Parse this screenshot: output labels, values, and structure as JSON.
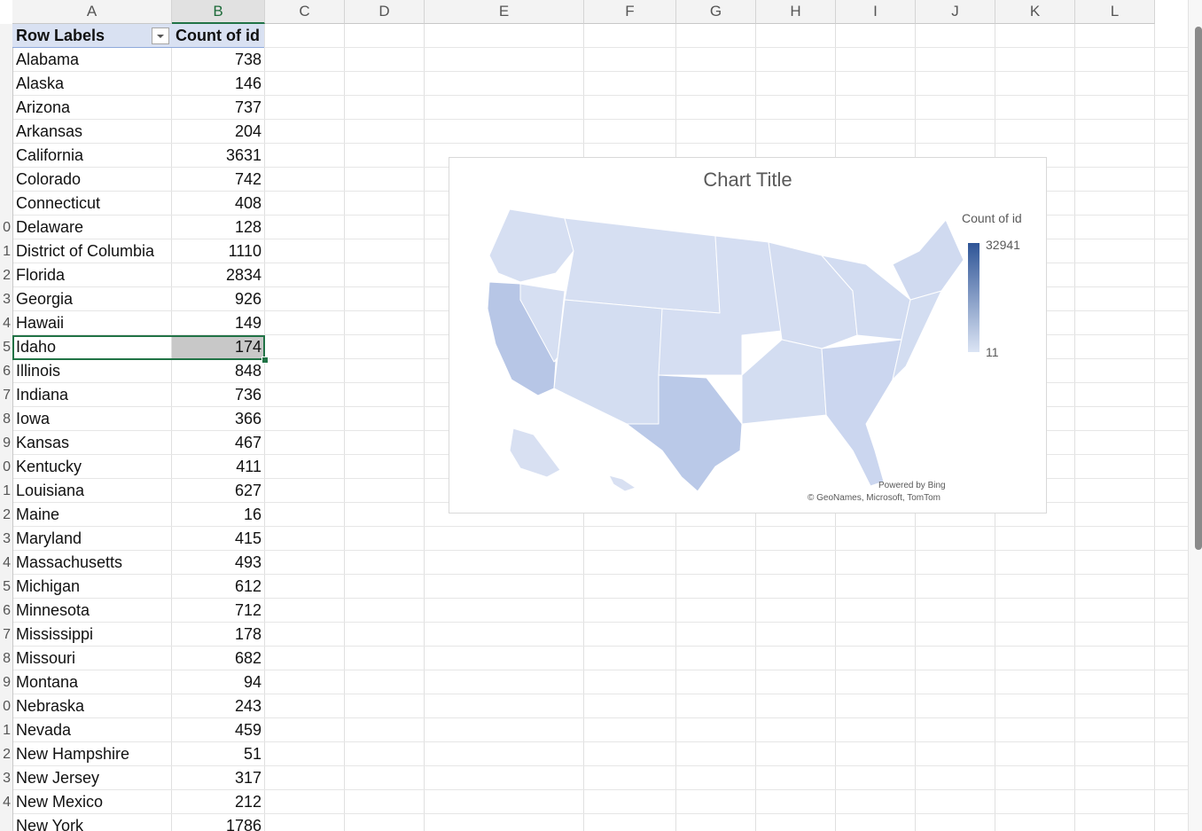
{
  "columns": [
    "A",
    "B",
    "C",
    "D",
    "E",
    "F",
    "G",
    "H",
    "I",
    "J",
    "K",
    "L"
  ],
  "active_column": "B",
  "row_numbers": [
    "",
    "",
    "",
    "",
    "",
    "",
    "",
    "",
    "",
    "0",
    "1",
    "2",
    "3",
    "4",
    "5",
    "6",
    "7",
    "8",
    "9",
    "0",
    "1",
    "2",
    "3",
    "4",
    "5",
    "6",
    "7",
    "8",
    "9",
    "0",
    "1",
    "2",
    "3",
    "4"
  ],
  "pivot": {
    "header_row_labels": "Row Labels",
    "header_count": "Count of id",
    "rows": [
      {
        "label": "Alabama",
        "value": "738"
      },
      {
        "label": "Alaska",
        "value": "146"
      },
      {
        "label": "Arizona",
        "value": "737"
      },
      {
        "label": "Arkansas",
        "value": "204"
      },
      {
        "label": "California",
        "value": "3631"
      },
      {
        "label": "Colorado",
        "value": "742"
      },
      {
        "label": "Connecticut",
        "value": "408"
      },
      {
        "label": "Delaware",
        "value": "128"
      },
      {
        "label": "District of Columbia",
        "value": "1110"
      },
      {
        "label": "Florida",
        "value": "2834"
      },
      {
        "label": "Georgia",
        "value": "926"
      },
      {
        "label": "Hawaii",
        "value": "149"
      },
      {
        "label": "Idaho",
        "value": "174"
      },
      {
        "label": "Illinois",
        "value": "848"
      },
      {
        "label": "Indiana",
        "value": "736"
      },
      {
        "label": "Iowa",
        "value": "366"
      },
      {
        "label": "Kansas",
        "value": "467"
      },
      {
        "label": "Kentucky",
        "value": "411"
      },
      {
        "label": "Louisiana",
        "value": "627"
      },
      {
        "label": "Maine",
        "value": "16"
      },
      {
        "label": "Maryland",
        "value": "415"
      },
      {
        "label": "Massachusetts",
        "value": "493"
      },
      {
        "label": "Michigan",
        "value": "612"
      },
      {
        "label": "Minnesota",
        "value": "712"
      },
      {
        "label": "Mississippi",
        "value": "178"
      },
      {
        "label": "Missouri",
        "value": "682"
      },
      {
        "label": "Montana",
        "value": "94"
      },
      {
        "label": "Nebraska",
        "value": "243"
      },
      {
        "label": "Nevada",
        "value": "459"
      },
      {
        "label": "New Hampshire",
        "value": "51"
      },
      {
        "label": "New Jersey",
        "value": "317"
      },
      {
        "label": "New Mexico",
        "value": "212"
      },
      {
        "label": "New York",
        "value": "1786"
      }
    ],
    "selected_label": "Idaho"
  },
  "map_chart": {
    "title": "Chart Title",
    "legend_title": "Count of id",
    "legend_max": "32941",
    "legend_min": "11",
    "color_max": "#2f5597",
    "color_min": "#dbe4f4",
    "powered_by": "Powered by Bing",
    "credits": "© GeoNames, Microsoft, TomTom"
  },
  "icons": {
    "filter": "dropdown-arrow-icon"
  }
}
